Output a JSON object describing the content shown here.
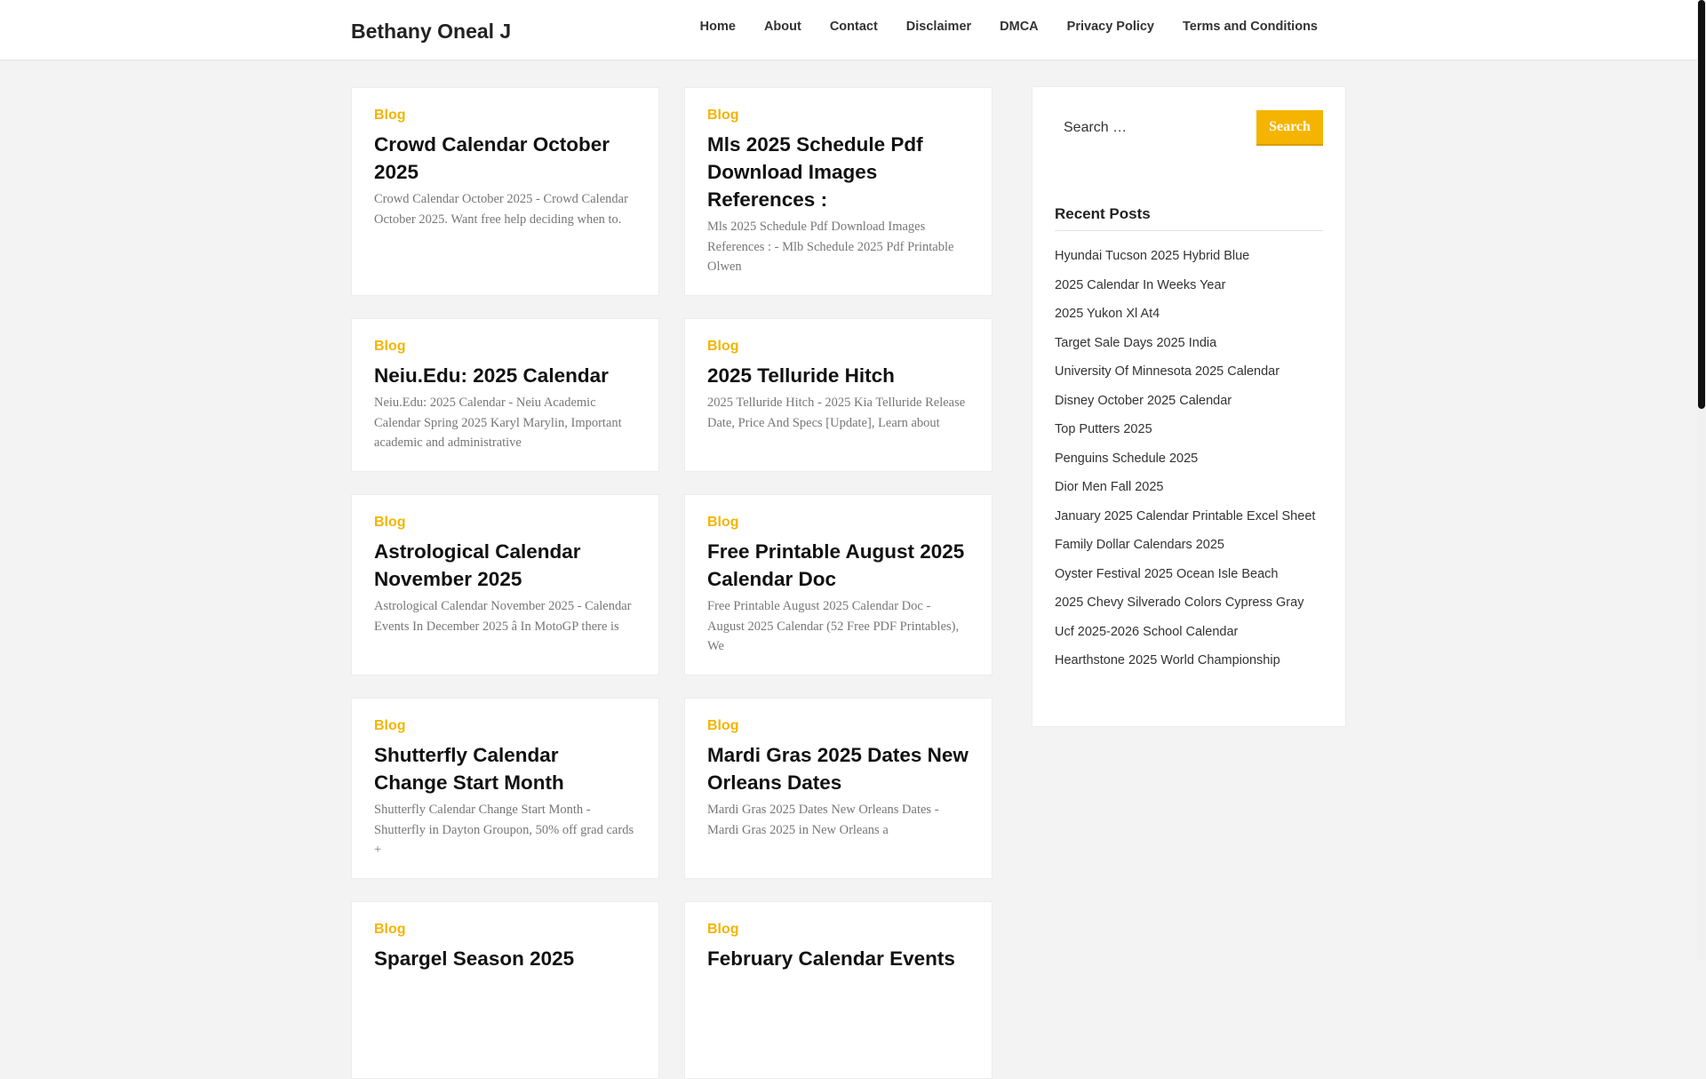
{
  "header": {
    "site_title": "Bethany Oneal J",
    "nav": [
      "Home",
      "About",
      "Contact",
      "Disclaimer",
      "DMCA",
      "Privacy Policy",
      "Terms and Conditions"
    ]
  },
  "posts": [
    {
      "category": "Blog",
      "title": "Crowd Calendar October 2025",
      "excerpt": "Crowd Calendar October 2025 - Crowd Calendar October 2025. Want free help deciding when to."
    },
    {
      "category": "Blog",
      "title": "Mls 2025 Schedule Pdf Download Images References :",
      "excerpt": "Mls 2025 Schedule Pdf Download Images References : - Mlb Schedule 2025 Pdf Printable Olwen"
    },
    {
      "category": "Blog",
      "title": "Neiu.Edu: 2025 Calendar",
      "excerpt": "Neiu.Edu: 2025 Calendar - Neiu Academic Calendar Spring 2025 Karyl Marylin, Important academic and administrative"
    },
    {
      "category": "Blog",
      "title": "2025 Telluride Hitch",
      "excerpt": "2025 Telluride Hitch - 2025 Kia Telluride Release Date, Price And Specs [Update], Learn about"
    },
    {
      "category": "Blog",
      "title": "Astrological Calendar November 2025",
      "excerpt": "Astrological Calendar November 2025 - Calendar Events In December 2025 â In MotoGP there is"
    },
    {
      "category": "Blog",
      "title": "Free Printable August 2025 Calendar Doc",
      "excerpt": "Free Printable August 2025 Calendar Doc - August 2025 Calendar (52 Free PDF Printables), We"
    },
    {
      "category": "Blog",
      "title": "Shutterfly Calendar Change Start Month",
      "excerpt": "Shutterfly Calendar Change Start Month - Shutterfly in Dayton Groupon, 50% off grad cards +"
    },
    {
      "category": "Blog",
      "title": "Mardi Gras 2025 Dates New Orleans Dates",
      "excerpt": "Mardi Gras 2025 Dates New Orleans Dates - Mardi Gras 2025 in New Orleans a"
    },
    {
      "category": "Blog",
      "title": "Spargel Season 2025",
      "excerpt": ""
    },
    {
      "category": "Blog",
      "title": "February Calendar Events",
      "excerpt": ""
    }
  ],
  "sidebar": {
    "search_placeholder": "Search …",
    "search_button": "Search",
    "recent_title": "Recent Posts",
    "recent_posts": [
      "Hyundai Tucson 2025 Hybrid Blue",
      "2025 Calendar In Weeks Year",
      "2025 Yukon Xl At4",
      "Target Sale Days 2025 India",
      "University Of Minnesota 2025 Calendar",
      "Disney October 2025 Calendar",
      "Top Putters 2025",
      "Penguins Schedule 2025",
      "Dior Men Fall 2025",
      "January 2025 Calendar Printable Excel Sheet",
      "Family Dollar Calendars 2025",
      "Oyster Festival 2025 Ocean Isle Beach",
      "2025 Chevy Silverado Colors Cypress Gray",
      "Ucf 2025-2026 School Calendar",
      "Hearthstone 2025 World Championship"
    ]
  },
  "colors": {
    "accent": "#f5b400",
    "background": "#f3f3f3"
  }
}
